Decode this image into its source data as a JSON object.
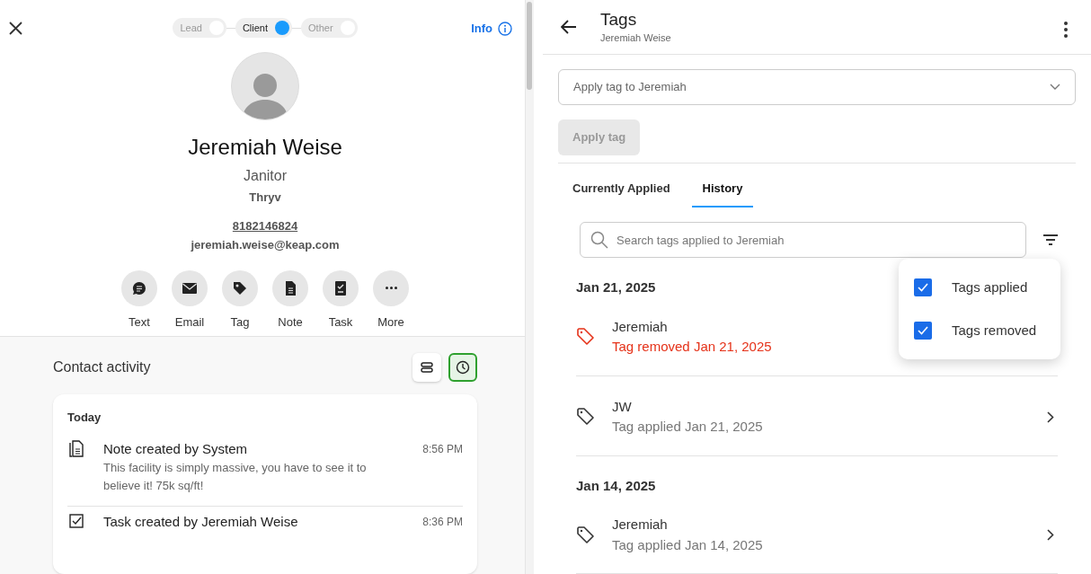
{
  "contact": {
    "stages": [
      {
        "label": "Lead",
        "selected": false
      },
      {
        "label": "Client",
        "selected": true
      },
      {
        "label": "Other",
        "selected": false
      }
    ],
    "info_link": "Info",
    "name": "Jeremiah Weise",
    "job_title": "Janitor",
    "company": "Thryv",
    "phone": "8182146824",
    "email": "jeremiah.weise@keap.com",
    "actions": [
      {
        "kind": "text",
        "label": "Text"
      },
      {
        "kind": "email",
        "label": "Email"
      },
      {
        "kind": "tag",
        "label": "Tag"
      },
      {
        "kind": "note",
        "label": "Note"
      },
      {
        "kind": "task",
        "label": "Task"
      },
      {
        "kind": "more",
        "label": "More"
      }
    ]
  },
  "activity": {
    "title": "Contact activity",
    "views": [
      {
        "kind": "list",
        "selected": false
      },
      {
        "kind": "timeline",
        "selected": true
      }
    ],
    "day": "Today",
    "items": [
      {
        "kind": "note",
        "title": "Note created by System",
        "time": "8:56 PM",
        "body": "This facility is simply massive, you have to see it to believe it! 75k sq/ft!"
      },
      {
        "kind": "task",
        "title": "Task created by Jeremiah Weise",
        "time": "8:36 PM"
      }
    ]
  },
  "tags_panel": {
    "title": "Tags",
    "subtitle": "Jeremiah Weise",
    "apply_placeholder": "Apply tag to Jeremiah",
    "apply_button": "Apply tag",
    "tabs": [
      {
        "label": "Currently Applied",
        "selected": false
      },
      {
        "label": "History",
        "selected": true
      }
    ],
    "search_placeholder": "Search tags applied to Jeremiah",
    "filter_menu": [
      {
        "label": "Tags applied",
        "checked": true
      },
      {
        "label": "Tags removed",
        "checked": true
      }
    ],
    "groups": [
      {
        "date": "Jan 21, 2025",
        "items": [
          {
            "kind": "removed",
            "name": "Jeremiah",
            "detail": "Tag removed Jan 21, 2025"
          },
          {
            "kind": "applied",
            "name": "JW",
            "detail": "Tag applied Jan 21, 2025"
          }
        ]
      },
      {
        "date": "Jan 14, 2025",
        "items": [
          {
            "kind": "applied",
            "name": "Jeremiah",
            "detail": "Tag applied Jan 14, 2025"
          }
        ]
      }
    ]
  }
}
